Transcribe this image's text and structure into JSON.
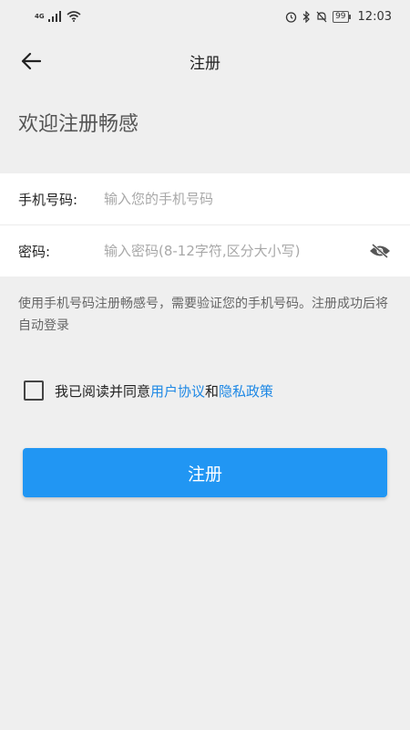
{
  "status_bar": {
    "network": "4G",
    "battery": "99",
    "time": "12:03"
  },
  "header": {
    "title": "注册",
    "back_icon": "arrow-left-icon"
  },
  "welcome_text": "欢迎注册畅感",
  "form": {
    "phone": {
      "label": "手机号码:",
      "placeholder": "输入您的手机号码",
      "value": ""
    },
    "password": {
      "label": "密码:",
      "placeholder": "输入密码(8-12字符,区分大小写)",
      "value": "",
      "toggle_icon": "eye-off-icon"
    }
  },
  "hint": "使用手机号码注册畅感号，需要验证您的手机号码。注册成功后将自动登录",
  "agreement": {
    "prefix": "我已阅读并同意",
    "user_agreement": "用户协议",
    "and": "和",
    "privacy_policy": "隐私政策",
    "checked": false
  },
  "submit_label": "注册",
  "colors": {
    "accent": "#2196f3",
    "link": "#1e88e5",
    "background": "#efefef"
  }
}
